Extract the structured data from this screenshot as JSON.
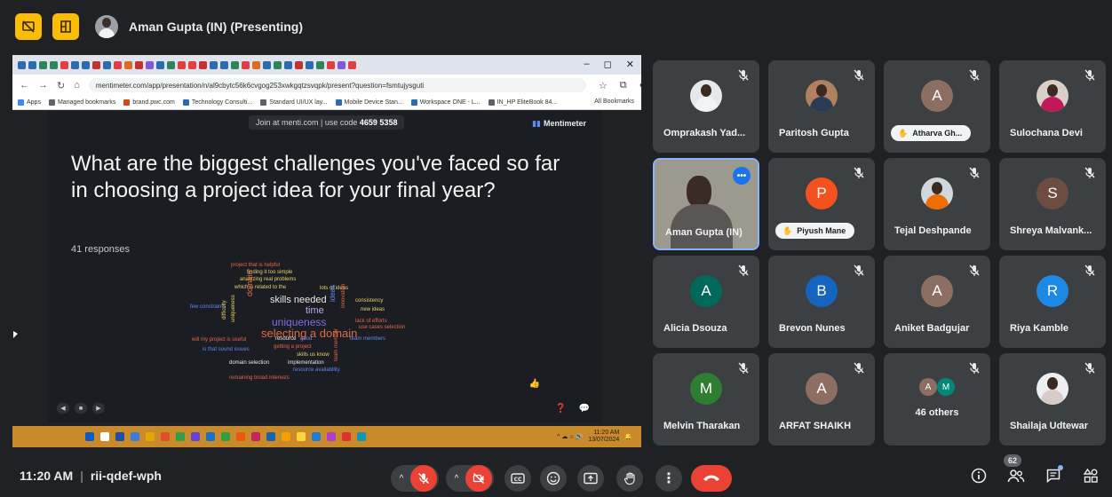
{
  "presenter": {
    "name": "Aman Gupta (IN) (Presenting)"
  },
  "colors": {
    "yellow": "#fbbc04",
    "red": "#ea4335",
    "tile": "#3c4043",
    "bg": "#202124",
    "blue": "#1a73e8"
  },
  "browser": {
    "url": "mentimeter.com/app/presentation/n/al9cbytc56k6cvgog253xwkgqtzsvqpk/present?question=fsmtujysguti",
    "bookmarks": [
      "Apps",
      "Managed bookmarks",
      "brand.pwc.com",
      "Technology Consulti...",
      "Standard UI/UX lay...",
      "Mobile Device Stan...",
      "Workspace ONE - L...",
      "IN_HP EliteBook 84..."
    ],
    "all_bookmarks": "All Bookmarks"
  },
  "menti": {
    "join_text": "Join at menti.com | use code ",
    "code": "4659 5358",
    "brand": "Mentimeter",
    "question": "What are the biggest challenges you've faced so far in choosing a project idea for your final year?",
    "responses": "41 responses",
    "words": [
      {
        "text": "project that is helpful",
        "color": "#e0694a"
      },
      {
        "text": "finding it too simple",
        "color": "#e8d36a"
      },
      {
        "text": "analyzing real problems",
        "color": "#e8d36a"
      },
      {
        "text": "which is related to the",
        "color": "#e8d36a"
      },
      {
        "text": "lots of ideas",
        "color": "#e8d36a"
      },
      {
        "text": "skills needed",
        "color": "#e8eaed"
      },
      {
        "text": "time",
        "color": "#b9a7f0"
      },
      {
        "text": "uniqueness",
        "color": "#7b6ff0"
      },
      {
        "text": "selecting a domain",
        "color": "#e0694a"
      },
      {
        "text": "domain",
        "color": "#e0694a"
      },
      {
        "text": "ideas",
        "color": "#5b8cf5"
      },
      {
        "text": "consistency",
        "color": "#e8d36a"
      },
      {
        "text": "new ideas",
        "color": "#e8d36a"
      },
      {
        "text": "lack of efforts",
        "color": "#e0694a"
      },
      {
        "text": "use cases selection",
        "color": "#e0694a"
      },
      {
        "text": "resource",
        "color": "#e8eaed"
      },
      {
        "text": "good",
        "color": "#5b8cf5"
      },
      {
        "text": "team members",
        "color": "#5b8cf5"
      },
      {
        "text": "getting a project",
        "color": "#e0694a"
      },
      {
        "text": "skills us know",
        "color": "#e8d36a"
      },
      {
        "text": "domain selection",
        "color": "#e8eaed"
      },
      {
        "text": "implementation",
        "color": "#e8eaed"
      },
      {
        "text": "resource availability",
        "color": "#5b8cf5"
      },
      {
        "text": "remaining broad interests",
        "color": "#e0694a"
      },
      {
        "text": "few constraints",
        "color": "#5b8cf5"
      },
      {
        "text": "will my project is useful",
        "color": "#e0694a"
      },
      {
        "text": "is that sound issues",
        "color": "#5b8cf5"
      },
      {
        "text": "difficulty",
        "color": "#e8d36a"
      },
      {
        "text": "uniqueness",
        "color": "#e8d36a"
      },
      {
        "text": "team member",
        "color": "#e0694a"
      },
      {
        "text": "innovation",
        "color": "#e0694a"
      }
    ]
  },
  "taskbar": {
    "time": "11:20 AM",
    "date": "13/07/2024"
  },
  "tiles": [
    {
      "name": "Omprakash Yad...",
      "type": "photo",
      "shirt": "#f1f3f4",
      "photo_bg": "#e6e8eb"
    },
    {
      "name": "Paritosh Gupta",
      "type": "photo",
      "shirt": "#2b3a55",
      "photo_bg": "#b08060"
    },
    {
      "name": "Atharva Gh...",
      "type": "letter",
      "letter": "A",
      "color": "#8d6e63",
      "hand": true
    },
    {
      "name": "Sulochana Devi",
      "type": "photo",
      "shirt": "#c2185b",
      "photo_bg": "#d9cfc7"
    },
    {
      "name": "Aman Gupta (IN)",
      "type": "video"
    },
    {
      "name": "Piyush Mane",
      "type": "letter",
      "letter": "P",
      "color": "#f4511e",
      "hand": true
    },
    {
      "name": "Tejal Deshpande",
      "type": "photo",
      "shirt": "#ef6c00",
      "photo_bg": "#cfd8dc"
    },
    {
      "name": "Shreya Malvank...",
      "type": "letter",
      "letter": "S",
      "color": "#6d4c41"
    },
    {
      "name": "Alicia Dsouza",
      "type": "letter",
      "letter": "A",
      "color": "#00695c"
    },
    {
      "name": "Brevon Nunes",
      "type": "letter",
      "letter": "B",
      "color": "#1565c0"
    },
    {
      "name": "Aniket Badgujar",
      "type": "letter",
      "letter": "A",
      "color": "#8d6e63"
    },
    {
      "name": "Riya Kamble",
      "type": "letter",
      "letter": "R",
      "color": "#1e88e5"
    },
    {
      "name": "Melvin Tharakan",
      "type": "letter",
      "letter": "M",
      "color": "#2e7d32"
    },
    {
      "name": "ARFAT SHAIKH",
      "type": "letter",
      "letter": "A",
      "color": "#8d6e63"
    },
    {
      "name": "46 others",
      "type": "others",
      "a": "A",
      "m": "M"
    },
    {
      "name": "Shailaja Udtewar",
      "type": "photo",
      "shirt": "#d7ccc8",
      "photo_bg": "#eceff1"
    }
  ],
  "meeting": {
    "time": "11:20 AM",
    "code": "rii-qdef-wph"
  },
  "participants_count": "62"
}
